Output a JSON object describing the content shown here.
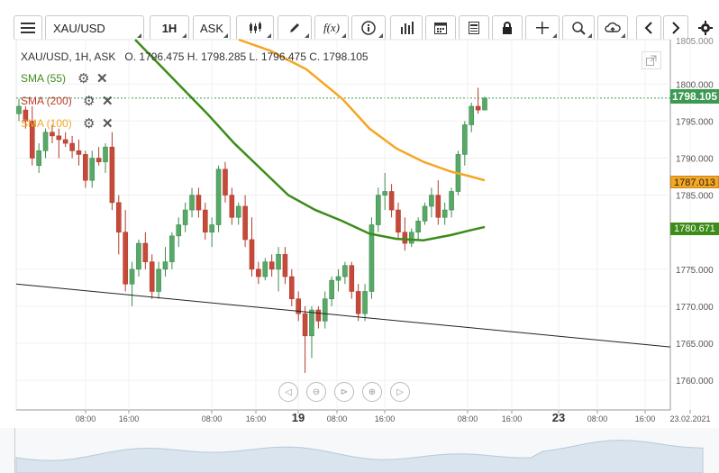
{
  "toolbar": {
    "symbol": "XAU/USD",
    "timeframe": "1H",
    "price_type": "ASK",
    "icons": [
      "menu-icon",
      "candles-icon",
      "pencil-icon",
      "fx-icon",
      "info-icon",
      "bars-icon",
      "calendar-icon",
      "news-icon",
      "lock-icon",
      "crosshair-icon",
      "zoom-icon",
      "cloud-upload-icon",
      "chevron-left-icon",
      "chevron-right-icon",
      "gear-icon"
    ]
  },
  "chart_header": {
    "instrument": "XAU/USD, 1H, ASK",
    "ohlc": "O. 1796.475 H. 1798.285 L. 1796.475 C. 1798.105"
  },
  "legend": [
    {
      "label": "SMA (55)",
      "color": "#3c8c1a"
    },
    {
      "label": "SMA (200)",
      "color": "#c0392b"
    },
    {
      "label": "SMA (100)",
      "color": "#f5a623"
    }
  ],
  "price_labels": {
    "last": "1798.105",
    "sma100": "1787.013",
    "sma55": "1780.671"
  },
  "chart_data": {
    "type": "candlestick",
    "ylim": [
      1756,
      1806
    ],
    "y_ticks": [
      "1800.000",
      "1795.000",
      "1790.000",
      "1785.000",
      "1775.000",
      "1770.000",
      "1765.000",
      "1760.000"
    ],
    "x_ticks": [
      "08:00",
      "16:00",
      "08:00",
      "16:00",
      "19",
      "08:00",
      "16:00",
      "08:00",
      "16:00",
      "23",
      "08:00",
      "16:00",
      "23.02.2021"
    ],
    "candles": [
      [
        1796.0,
        1798.0,
        1795.0,
        1797.0
      ],
      [
        1796.5,
        1797.0,
        1794.0,
        1795.0
      ],
      [
        1795.0,
        1797.0,
        1789.0,
        1790.0
      ],
      [
        1789.0,
        1792.0,
        1788.0,
        1791.0
      ],
      [
        1791.0,
        1794.0,
        1790.0,
        1793.5
      ],
      [
        1793.5,
        1794.5,
        1792.0,
        1793.0
      ],
      [
        1793.0,
        1794.0,
        1790.0,
        1792.5
      ],
      [
        1792.5,
        1793.5,
        1791.5,
        1792.0
      ],
      [
        1792.0,
        1793.0,
        1790.0,
        1791.0
      ],
      [
        1791.0,
        1792.5,
        1789.0,
        1790.5
      ],
      [
        1790.5,
        1791.0,
        1786.0,
        1787.0
      ],
      [
        1787.0,
        1791.0,
        1786.0,
        1790.0
      ],
      [
        1790.0,
        1791.5,
        1789.0,
        1789.5
      ],
      [
        1789.5,
        1792.0,
        1788.0,
        1791.5
      ],
      [
        1791.5,
        1793.5,
        1783.0,
        1784.0
      ],
      [
        1784.0,
        1785.0,
        1777.0,
        1780.0
      ],
      [
        1780.0,
        1783.0,
        1772.0,
        1773.0
      ],
      [
        1773.0,
        1776.0,
        1770.0,
        1775.0
      ],
      [
        1775.0,
        1779.0,
        1774.0,
        1778.5
      ],
      [
        1778.5,
        1780.0,
        1775.0,
        1776.0
      ],
      [
        1776.0,
        1777.0,
        1771.0,
        1772.0
      ],
      [
        1772.0,
        1776.0,
        1771.0,
        1775.0
      ],
      [
        1775.0,
        1778.0,
        1774.0,
        1776.0
      ],
      [
        1776.0,
        1780.0,
        1775.0,
        1779.5
      ],
      [
        1779.5,
        1782.0,
        1778.0,
        1781.0
      ],
      [
        1781.0,
        1784.0,
        1780.0,
        1783.0
      ],
      [
        1783.0,
        1786.0,
        1782.0,
        1785.0
      ],
      [
        1785.0,
        1786.0,
        1782.0,
        1783.0
      ],
      [
        1783.0,
        1784.0,
        1779.0,
        1780.0
      ],
      [
        1780.0,
        1782.0,
        1778.0,
        1781.0
      ],
      [
        1781.0,
        1789.0,
        1780.0,
        1788.5
      ],
      [
        1788.5,
        1789.5,
        1784.0,
        1785.0
      ],
      [
        1785.0,
        1786.0,
        1781.0,
        1782.0
      ],
      [
        1782.0,
        1784.0,
        1781.0,
        1783.5
      ],
      [
        1783.5,
        1785.0,
        1778.0,
        1779.0
      ],
      [
        1779.0,
        1782.0,
        1774.0,
        1775.0
      ],
      [
        1775.0,
        1776.0,
        1773.0,
        1774.0
      ],
      [
        1774.0,
        1776.5,
        1773.5,
        1776.0
      ],
      [
        1776.0,
        1777.0,
        1774.0,
        1775.0
      ],
      [
        1775.0,
        1778.0,
        1772.0,
        1777.0
      ],
      [
        1777.0,
        1778.0,
        1773.0,
        1774.0
      ],
      [
        1774.0,
        1775.0,
        1770.0,
        1771.0
      ],
      [
        1771.0,
        1772.0,
        1768.0,
        1769.0
      ],
      [
        1769.0,
        1770.0,
        1761.0,
        1766.0
      ],
      [
        1766.0,
        1770.0,
        1763.0,
        1769.5
      ],
      [
        1769.5,
        1770.0,
        1767.0,
        1768.0
      ],
      [
        1768.0,
        1772.0,
        1767.0,
        1771.0
      ],
      [
        1771.0,
        1774.0,
        1770.0,
        1773.5
      ],
      [
        1773.5,
        1775.0,
        1772.0,
        1774.0
      ],
      [
        1774.0,
        1776.0,
        1773.0,
        1775.5
      ],
      [
        1775.5,
        1776.0,
        1771.0,
        1772.0
      ],
      [
        1772.0,
        1773.0,
        1768.0,
        1769.0
      ],
      [
        1769.0,
        1773.0,
        1768.0,
        1772.0
      ],
      [
        1772.0,
        1782.0,
        1771.0,
        1781.0
      ],
      [
        1781.0,
        1786.0,
        1780.0,
        1785.0
      ],
      [
        1785.0,
        1788.0,
        1783.0,
        1785.5
      ],
      [
        1785.5,
        1786.5,
        1782.0,
        1783.0
      ],
      [
        1783.0,
        1784.0,
        1779.0,
        1780.0
      ],
      [
        1780.0,
        1782.0,
        1777.5,
        1778.5
      ],
      [
        1778.5,
        1780.5,
        1778.0,
        1780.0
      ],
      [
        1780.0,
        1782.0,
        1779.0,
        1781.5
      ],
      [
        1781.5,
        1784.0,
        1781.0,
        1783.5
      ],
      [
        1783.5,
        1786.0,
        1782.0,
        1785.0
      ],
      [
        1785.0,
        1787.0,
        1781.0,
        1782.0
      ],
      [
        1782.0,
        1784.0,
        1781.0,
        1783.0
      ],
      [
        1783.0,
        1786.0,
        1782.0,
        1785.5
      ],
      [
        1785.5,
        1791.0,
        1785.0,
        1790.5
      ],
      [
        1790.5,
        1795.0,
        1789.0,
        1794.5
      ],
      [
        1794.5,
        1797.5,
        1793.5,
        1797.0
      ],
      [
        1797.0,
        1799.5,
        1796.0,
        1796.5
      ],
      [
        1796.5,
        1798.3,
        1796.5,
        1798.1
      ]
    ],
    "sma55": [
      [
        150,
        1806
      ],
      [
        190,
        1801
      ],
      [
        230,
        1796
      ],
      [
        260,
        1792
      ],
      [
        290,
        1788.5
      ],
      [
        320,
        1785
      ],
      [
        350,
        1783
      ],
      [
        380,
        1781.5
      ],
      [
        410,
        1779.8
      ],
      [
        440,
        1779.1
      ],
      [
        470,
        1778.9
      ],
      [
        500,
        1779.6
      ],
      [
        520,
        1780.2
      ],
      [
        538,
        1780.7
      ]
    ],
    "sma100": [
      [
        265,
        1806
      ],
      [
        300,
        1804.5
      ],
      [
        340,
        1802
      ],
      [
        380,
        1798
      ],
      [
        410,
        1794
      ],
      [
        440,
        1791.3
      ],
      [
        470,
        1789.5
      ],
      [
        500,
        1788.2
      ],
      [
        520,
        1787.6
      ],
      [
        538,
        1787.0
      ]
    ],
    "trendline": [
      [
        18,
        1773.0
      ],
      [
        744,
        1764.5
      ]
    ]
  }
}
